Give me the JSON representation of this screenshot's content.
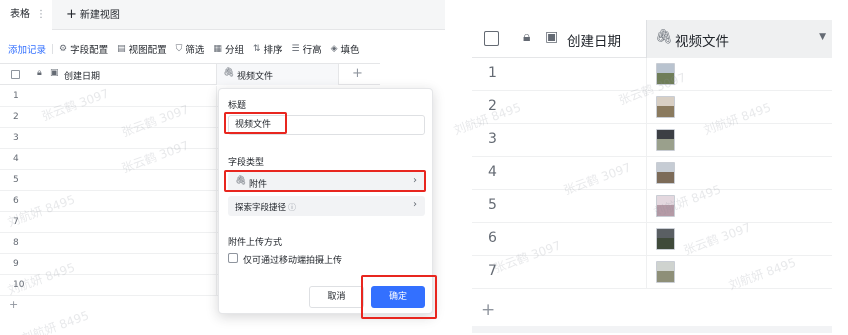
{
  "left": {
    "tabs": {
      "active_label": "表格",
      "kebab": "⋮",
      "new_view_label": "新建视图"
    },
    "toolbar": {
      "add_record": "添加记录",
      "field_config": "字段配置",
      "view_config": "视图配置",
      "filter": "筛选",
      "group": "分组",
      "sort": "排序",
      "row_height": "行高",
      "fill_color": "填色"
    },
    "grid": {
      "columns": [
        "创建日期",
        "视频文件"
      ],
      "add_column": "+",
      "rows": [
        "1",
        "2",
        "3",
        "4",
        "5",
        "6",
        "7",
        "8",
        "9",
        "10"
      ],
      "add_row": "+"
    },
    "dialog": {
      "title_label": "标题",
      "title_value": "视频文件",
      "field_type_label": "字段类型",
      "field_type_value": "附件",
      "explore_label": "探索字段捷径",
      "upload_mode_label": "附件上传方式",
      "upload_option": "仅可通过移动端拍摄上传",
      "cancel": "取消",
      "confirm": "确定"
    }
  },
  "right": {
    "columns": [
      "创建日期",
      "视频文件"
    ],
    "rows": [
      "1",
      "2",
      "3",
      "4",
      "5",
      "6",
      "7"
    ],
    "add_row": "+"
  },
  "watermarks": [
    "刘航妍 8495",
    "张云鹤 3097"
  ],
  "colors": {
    "accent": "#3370ff",
    "highlight": "#e8261f"
  }
}
